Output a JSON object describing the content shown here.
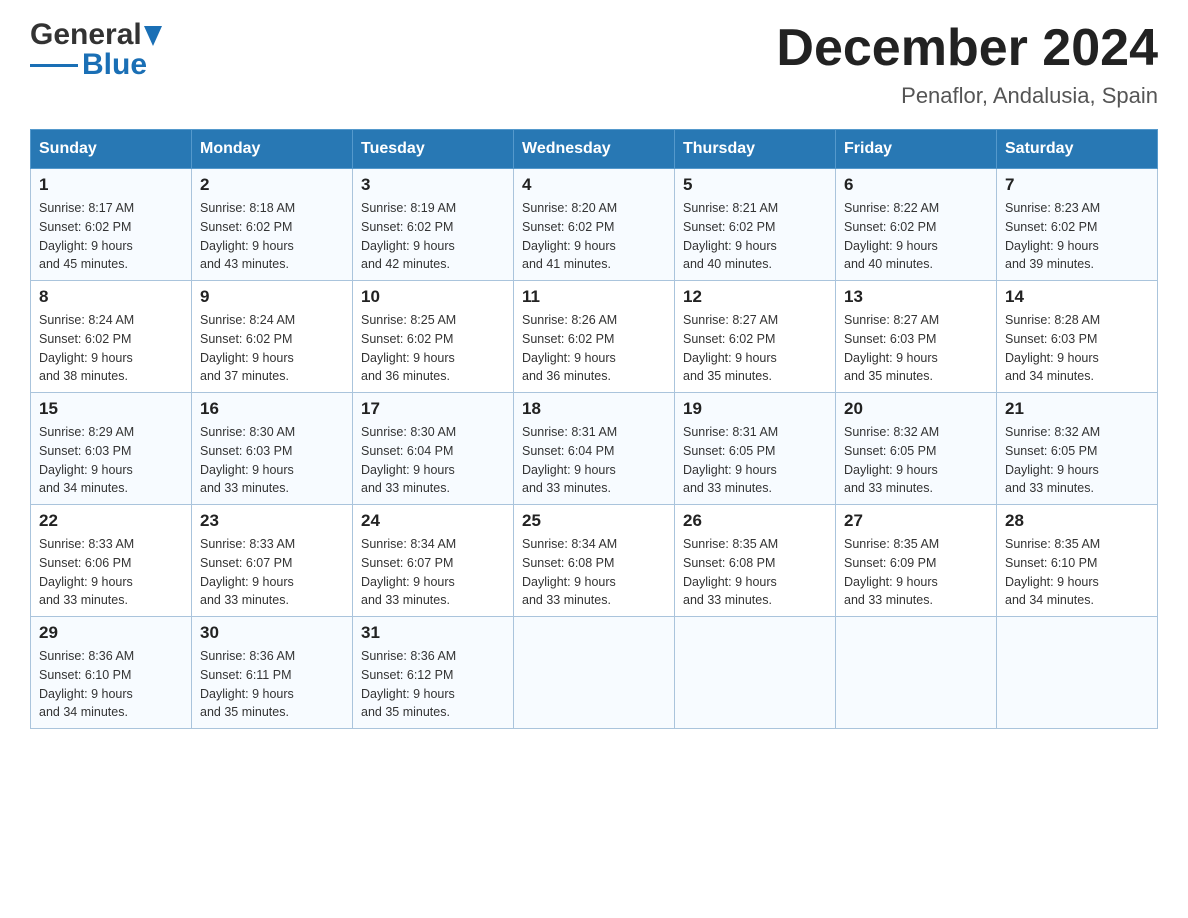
{
  "logo": {
    "general": "General",
    "blue": "Blue"
  },
  "title": {
    "month_year": "December 2024",
    "location": "Penaflor, Andalusia, Spain"
  },
  "headers": [
    "Sunday",
    "Monday",
    "Tuesday",
    "Wednesday",
    "Thursday",
    "Friday",
    "Saturday"
  ],
  "weeks": [
    [
      {
        "day": "1",
        "sunrise": "Sunrise: 8:17 AM",
        "sunset": "Sunset: 6:02 PM",
        "daylight": "Daylight: 9 hours",
        "daylight2": "and 45 minutes."
      },
      {
        "day": "2",
        "sunrise": "Sunrise: 8:18 AM",
        "sunset": "Sunset: 6:02 PM",
        "daylight": "Daylight: 9 hours",
        "daylight2": "and 43 minutes."
      },
      {
        "day": "3",
        "sunrise": "Sunrise: 8:19 AM",
        "sunset": "Sunset: 6:02 PM",
        "daylight": "Daylight: 9 hours",
        "daylight2": "and 42 minutes."
      },
      {
        "day": "4",
        "sunrise": "Sunrise: 8:20 AM",
        "sunset": "Sunset: 6:02 PM",
        "daylight": "Daylight: 9 hours",
        "daylight2": "and 41 minutes."
      },
      {
        "day": "5",
        "sunrise": "Sunrise: 8:21 AM",
        "sunset": "Sunset: 6:02 PM",
        "daylight": "Daylight: 9 hours",
        "daylight2": "and 40 minutes."
      },
      {
        "day": "6",
        "sunrise": "Sunrise: 8:22 AM",
        "sunset": "Sunset: 6:02 PM",
        "daylight": "Daylight: 9 hours",
        "daylight2": "and 40 minutes."
      },
      {
        "day": "7",
        "sunrise": "Sunrise: 8:23 AM",
        "sunset": "Sunset: 6:02 PM",
        "daylight": "Daylight: 9 hours",
        "daylight2": "and 39 minutes."
      }
    ],
    [
      {
        "day": "8",
        "sunrise": "Sunrise: 8:24 AM",
        "sunset": "Sunset: 6:02 PM",
        "daylight": "Daylight: 9 hours",
        "daylight2": "and 38 minutes."
      },
      {
        "day": "9",
        "sunrise": "Sunrise: 8:24 AM",
        "sunset": "Sunset: 6:02 PM",
        "daylight": "Daylight: 9 hours",
        "daylight2": "and 37 minutes."
      },
      {
        "day": "10",
        "sunrise": "Sunrise: 8:25 AM",
        "sunset": "Sunset: 6:02 PM",
        "daylight": "Daylight: 9 hours",
        "daylight2": "and 36 minutes."
      },
      {
        "day": "11",
        "sunrise": "Sunrise: 8:26 AM",
        "sunset": "Sunset: 6:02 PM",
        "daylight": "Daylight: 9 hours",
        "daylight2": "and 36 minutes."
      },
      {
        "day": "12",
        "sunrise": "Sunrise: 8:27 AM",
        "sunset": "Sunset: 6:02 PM",
        "daylight": "Daylight: 9 hours",
        "daylight2": "and 35 minutes."
      },
      {
        "day": "13",
        "sunrise": "Sunrise: 8:27 AM",
        "sunset": "Sunset: 6:03 PM",
        "daylight": "Daylight: 9 hours",
        "daylight2": "and 35 minutes."
      },
      {
        "day": "14",
        "sunrise": "Sunrise: 8:28 AM",
        "sunset": "Sunset: 6:03 PM",
        "daylight": "Daylight: 9 hours",
        "daylight2": "and 34 minutes."
      }
    ],
    [
      {
        "day": "15",
        "sunrise": "Sunrise: 8:29 AM",
        "sunset": "Sunset: 6:03 PM",
        "daylight": "Daylight: 9 hours",
        "daylight2": "and 34 minutes."
      },
      {
        "day": "16",
        "sunrise": "Sunrise: 8:30 AM",
        "sunset": "Sunset: 6:03 PM",
        "daylight": "Daylight: 9 hours",
        "daylight2": "and 33 minutes."
      },
      {
        "day": "17",
        "sunrise": "Sunrise: 8:30 AM",
        "sunset": "Sunset: 6:04 PM",
        "daylight": "Daylight: 9 hours",
        "daylight2": "and 33 minutes."
      },
      {
        "day": "18",
        "sunrise": "Sunrise: 8:31 AM",
        "sunset": "Sunset: 6:04 PM",
        "daylight": "Daylight: 9 hours",
        "daylight2": "and 33 minutes."
      },
      {
        "day": "19",
        "sunrise": "Sunrise: 8:31 AM",
        "sunset": "Sunset: 6:05 PM",
        "daylight": "Daylight: 9 hours",
        "daylight2": "and 33 minutes."
      },
      {
        "day": "20",
        "sunrise": "Sunrise: 8:32 AM",
        "sunset": "Sunset: 6:05 PM",
        "daylight": "Daylight: 9 hours",
        "daylight2": "and 33 minutes."
      },
      {
        "day": "21",
        "sunrise": "Sunrise: 8:32 AM",
        "sunset": "Sunset: 6:05 PM",
        "daylight": "Daylight: 9 hours",
        "daylight2": "and 33 minutes."
      }
    ],
    [
      {
        "day": "22",
        "sunrise": "Sunrise: 8:33 AM",
        "sunset": "Sunset: 6:06 PM",
        "daylight": "Daylight: 9 hours",
        "daylight2": "and 33 minutes."
      },
      {
        "day": "23",
        "sunrise": "Sunrise: 8:33 AM",
        "sunset": "Sunset: 6:07 PM",
        "daylight": "Daylight: 9 hours",
        "daylight2": "and 33 minutes."
      },
      {
        "day": "24",
        "sunrise": "Sunrise: 8:34 AM",
        "sunset": "Sunset: 6:07 PM",
        "daylight": "Daylight: 9 hours",
        "daylight2": "and 33 minutes."
      },
      {
        "day": "25",
        "sunrise": "Sunrise: 8:34 AM",
        "sunset": "Sunset: 6:08 PM",
        "daylight": "Daylight: 9 hours",
        "daylight2": "and 33 minutes."
      },
      {
        "day": "26",
        "sunrise": "Sunrise: 8:35 AM",
        "sunset": "Sunset: 6:08 PM",
        "daylight": "Daylight: 9 hours",
        "daylight2": "and 33 minutes."
      },
      {
        "day": "27",
        "sunrise": "Sunrise: 8:35 AM",
        "sunset": "Sunset: 6:09 PM",
        "daylight": "Daylight: 9 hours",
        "daylight2": "and 33 minutes."
      },
      {
        "day": "28",
        "sunrise": "Sunrise: 8:35 AM",
        "sunset": "Sunset: 6:10 PM",
        "daylight": "Daylight: 9 hours",
        "daylight2": "and 34 minutes."
      }
    ],
    [
      {
        "day": "29",
        "sunrise": "Sunrise: 8:36 AM",
        "sunset": "Sunset: 6:10 PM",
        "daylight": "Daylight: 9 hours",
        "daylight2": "and 34 minutes."
      },
      {
        "day": "30",
        "sunrise": "Sunrise: 8:36 AM",
        "sunset": "Sunset: 6:11 PM",
        "daylight": "Daylight: 9 hours",
        "daylight2": "and 35 minutes."
      },
      {
        "day": "31",
        "sunrise": "Sunrise: 8:36 AM",
        "sunset": "Sunset: 6:12 PM",
        "daylight": "Daylight: 9 hours",
        "daylight2": "and 35 minutes."
      },
      {
        "day": "",
        "sunrise": "",
        "sunset": "",
        "daylight": "",
        "daylight2": ""
      },
      {
        "day": "",
        "sunrise": "",
        "sunset": "",
        "daylight": "",
        "daylight2": ""
      },
      {
        "day": "",
        "sunrise": "",
        "sunset": "",
        "daylight": "",
        "daylight2": ""
      },
      {
        "day": "",
        "sunrise": "",
        "sunset": "",
        "daylight": "",
        "daylight2": ""
      }
    ]
  ]
}
